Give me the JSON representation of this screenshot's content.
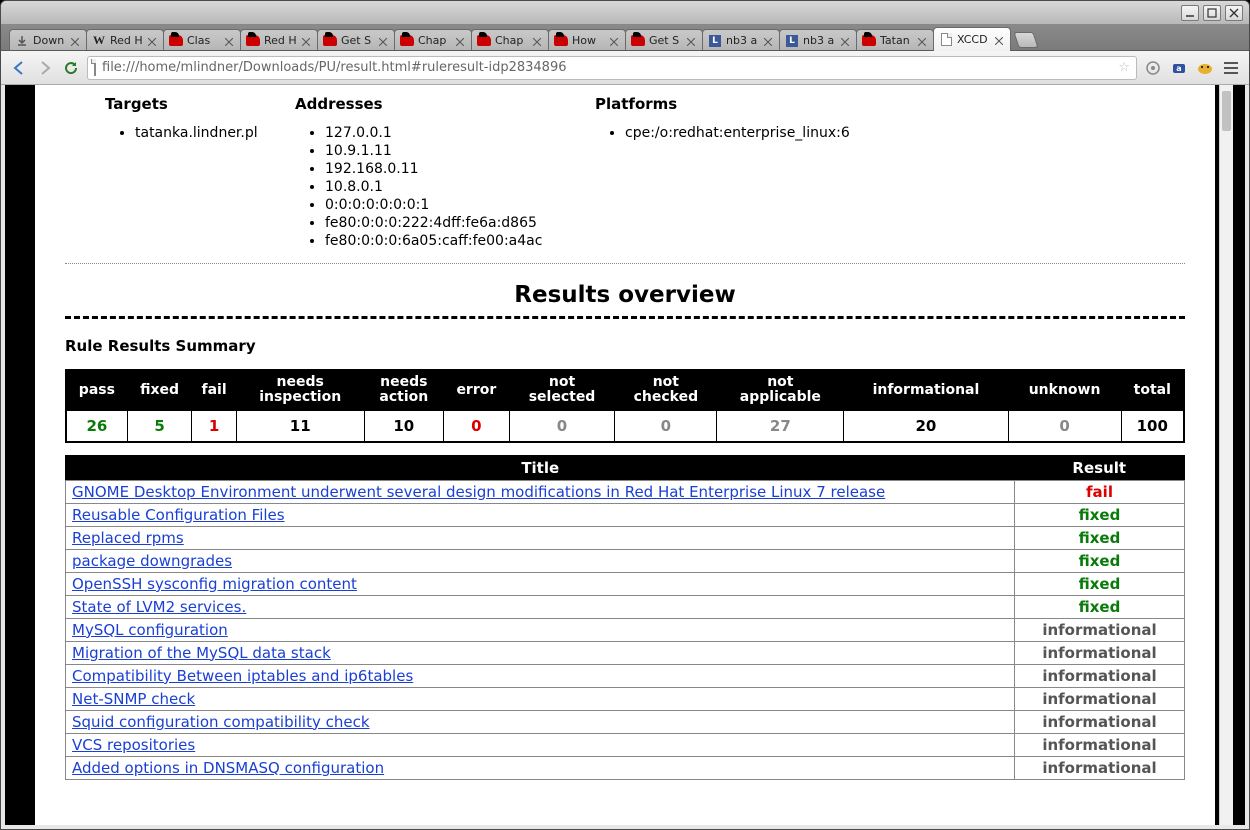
{
  "tabs": [
    {
      "label": "Down",
      "icon": "dl"
    },
    {
      "label": "Red H",
      "icon": "wiki"
    },
    {
      "label": "Clas",
      "icon": "rh"
    },
    {
      "label": "Red H",
      "icon": "rh"
    },
    {
      "label": "Get S",
      "icon": "rh"
    },
    {
      "label": "Chap",
      "icon": "rh"
    },
    {
      "label": "Chap",
      "icon": "rh"
    },
    {
      "label": "How",
      "icon": "rh"
    },
    {
      "label": "Get S",
      "icon": "rh"
    },
    {
      "label": "nb3 a",
      "icon": "l"
    },
    {
      "label": "nb3 a",
      "icon": "l"
    },
    {
      "label": "Tatan",
      "icon": "rh"
    },
    {
      "label": "XCCD",
      "icon": "file",
      "active": true
    }
  ],
  "url": "file:///home/mlindner/Downloads/PU/result.html#ruleresult-idp2834896",
  "headers": {
    "targets": "Targets",
    "addresses": "Addresses",
    "platforms": "Platforms"
  },
  "targets": [
    "tatanka.lindner.pl"
  ],
  "addresses": [
    "127.0.0.1",
    "10.9.1.11",
    "192.168.0.11",
    "10.8.0.1",
    "0:0:0:0:0:0:0:1",
    "fe80:0:0:0:222:4dff:fe6a:d865",
    "fe80:0:0:0:6a05:caff:fe00:a4ac"
  ],
  "platforms": [
    "cpe:/o:redhat:enterprise_linux:6"
  ],
  "overview_title": "Results overview",
  "summary_title": "Rule Results Summary",
  "summary_headers": [
    "pass",
    "fixed",
    "fail",
    "needs inspection",
    "needs action",
    "error",
    "not selected",
    "not checked",
    "not applicable",
    "informational",
    "unknown",
    "total"
  ],
  "summary_values": [
    {
      "v": "26",
      "c": "c-green"
    },
    {
      "v": "5",
      "c": "c-green"
    },
    {
      "v": "1",
      "c": "c-red"
    },
    {
      "v": "11",
      "c": "c-black"
    },
    {
      "v": "10",
      "c": "c-black"
    },
    {
      "v": "0",
      "c": "c-red"
    },
    {
      "v": "0",
      "c": "c-gray"
    },
    {
      "v": "0",
      "c": "c-gray"
    },
    {
      "v": "27",
      "c": "c-gray"
    },
    {
      "v": "20",
      "c": "c-black"
    },
    {
      "v": "0",
      "c": "c-gray"
    },
    {
      "v": "100",
      "c": "c-black"
    }
  ],
  "results_headers": {
    "title": "Title",
    "result": "Result"
  },
  "results": [
    {
      "title": "GNOME Desktop Environment underwent several design modifications in Red Hat Enterprise Linux 7 release",
      "result": "fail",
      "cls": "r-fail"
    },
    {
      "title": "Reusable Configuration Files",
      "result": "fixed",
      "cls": "r-fixed"
    },
    {
      "title": "Replaced rpms",
      "result": "fixed",
      "cls": "r-fixed"
    },
    {
      "title": "package downgrades",
      "result": "fixed",
      "cls": "r-fixed"
    },
    {
      "title": "OpenSSH sysconfig migration content",
      "result": "fixed",
      "cls": "r-fixed"
    },
    {
      "title": "State of LVM2 services.",
      "result": "fixed",
      "cls": "r-fixed"
    },
    {
      "title": "MySQL configuration",
      "result": "informational",
      "cls": "r-info"
    },
    {
      "title": "Migration of the MySQL data stack",
      "result": "informational",
      "cls": "r-info"
    },
    {
      "title": "Compatibility Between iptables and ip6tables",
      "result": "informational",
      "cls": "r-info"
    },
    {
      "title": "Net-SNMP check",
      "result": "informational",
      "cls": "r-info"
    },
    {
      "title": "Squid configuration compatibility check",
      "result": "informational",
      "cls": "r-info"
    },
    {
      "title": "VCS repositories",
      "result": "informational",
      "cls": "r-info"
    },
    {
      "title": "Added options in DNSMASQ configuration",
      "result": "informational",
      "cls": "r-info"
    }
  ]
}
